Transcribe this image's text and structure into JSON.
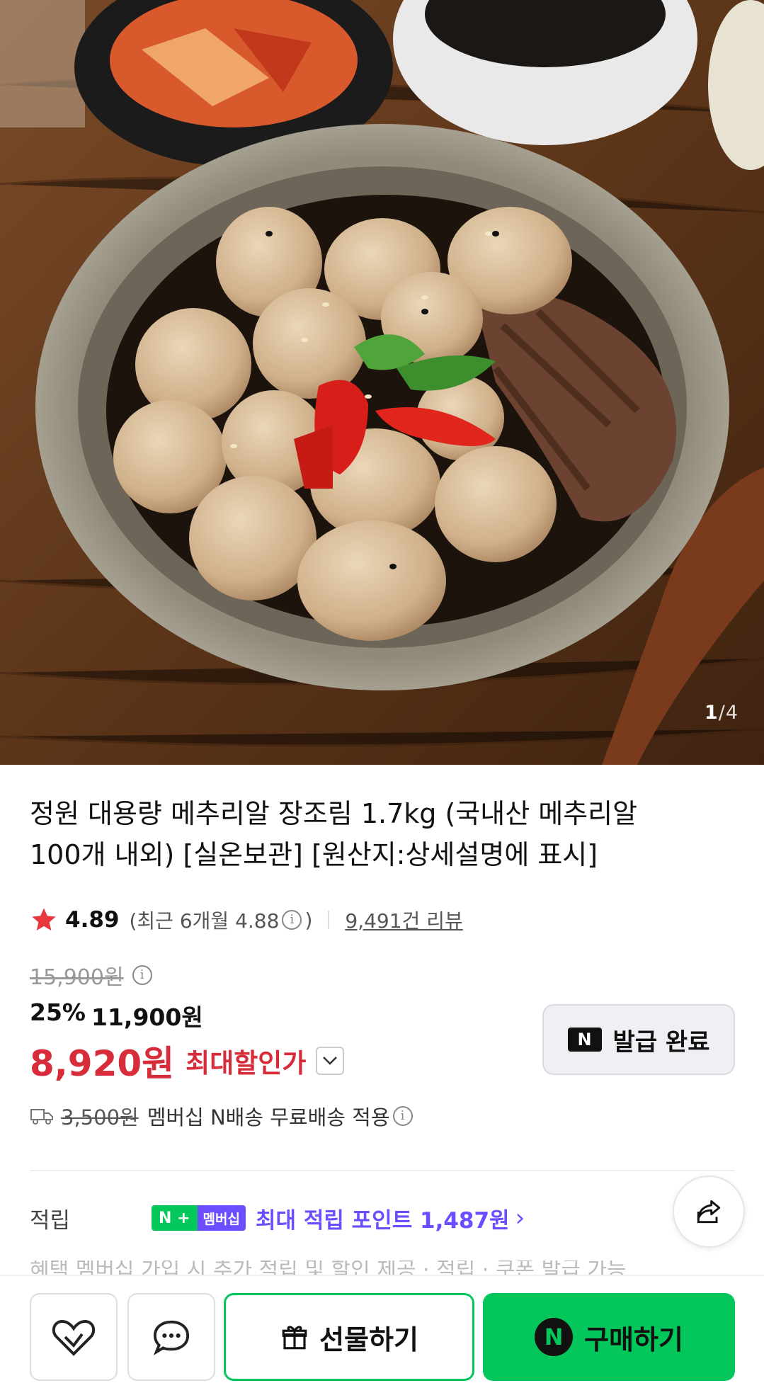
{
  "gallery": {
    "image_alt": "quail eggs braised in soy sauce with beef and peppers",
    "current": "1",
    "separator": "/",
    "total": "4"
  },
  "product": {
    "title_line1": "정원 대용량 메추리알 장조림 1.7kg (국내산 메추리알",
    "title_line2": "100개 내외) [실온보관] [원산지:상세설명에 표시]"
  },
  "rating": {
    "score": "4.89",
    "recent_prefix": "(최근 6개월 4.88",
    "recent_suffix": ")",
    "reviews": "9,491건 리뷰"
  },
  "price": {
    "original": "15,900원",
    "discount_rate": "25%",
    "sale_price": "11,900원",
    "max_discount_price": "8,920원",
    "max_discount_label": "최대할인가"
  },
  "coupon": {
    "n_label": "N",
    "label": "발급 완료"
  },
  "delivery": {
    "original_fee": "3,500원",
    "text": "멤버십 N배송 무료배송 적용"
  },
  "points": {
    "label": "적립",
    "badge_n": "N",
    "badge_plus": "+",
    "badge_membership": "멤버십",
    "text": "최대 적립 포인트 1,487원",
    "arrow": "›"
  },
  "next_row": {
    "partial_text": "혜택        멤버십 가입 시 추가 적립 및 할인 제공 · 적립 · 쿠폰 발급 가능"
  },
  "bottom_bar": {
    "gift_label": "선물하기",
    "buy_label": "구매하기",
    "buy_n": "N"
  },
  "colors": {
    "naver_green": "#03c75a",
    "price_red": "#d72c3a",
    "membership_purple": "#6b4eff",
    "star_red": "#e8373e"
  }
}
